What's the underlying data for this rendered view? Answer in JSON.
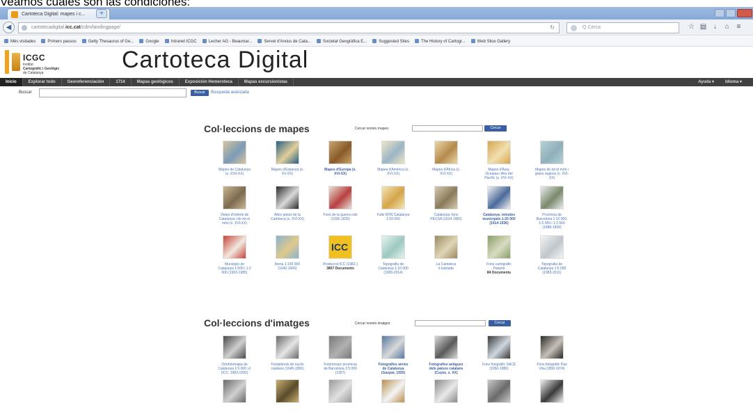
{
  "caption": "Veamos cuáles son las condiciones:",
  "browser": {
    "tab_title": "Cartoteca Digital: mapes i c...",
    "url_path": "cartotecadigital.",
    "url_domain": "icc.cat",
    "url_rest": "/cdm/landingpage/",
    "search_placeholder": "Q Cerca",
    "bookmarks": [
      "Més visitades",
      "Primers passos",
      "Getty Thesaurus of Ge...",
      "Google",
      "Intranet ICGC",
      "Lecher AG - Beaumar...",
      "Servei d'Arxius de Cata...",
      "Societat Geogràfica E...",
      "Suggested Sites",
      "The History of Cartogr...",
      "Web Slice Gallery"
    ]
  },
  "site": {
    "logo_title": "ICGC",
    "logo_line1": "Institut",
    "logo_line2": "Cartogràfic i Geològic",
    "logo_line3": "de Catalunya",
    "title": "Cartoteca Digital"
  },
  "menu": {
    "items": [
      "Inicio",
      "Explorar todo",
      "Georeferenciación",
      "1714",
      "Mapas geológicos",
      "Exposición Hemeroteca",
      "Mapas excursionistas"
    ],
    "right": [
      "Ayuda",
      "Idioma"
    ]
  },
  "search": {
    "label": "Buscar",
    "button": "Buscar",
    "advanced": "Búsqueda avanzada"
  },
  "maps_section": {
    "title": "Col·leccions de mapes",
    "search_label": "Cercar només mapes:",
    "button": "Cercar",
    "items": [
      {
        "caption": "Mapes de Catalunya (s. XVII-XX)",
        "thumb": "catalunya"
      },
      {
        "caption": "Mapes d'Espanya (s. XV-XX)",
        "thumb": "espanya"
      },
      {
        "caption": "Mapes d'Europa (s. XVI-XX)",
        "thumb": "europa",
        "bold": true
      },
      {
        "caption": "Mapes d'Amèrica (s. XVI-XX)",
        "thumb": "america"
      },
      {
        "caption": "Mapes d'Àfrica (s. XVI-XX)",
        "thumb": "africa"
      },
      {
        "caption": "Mapes d'Àsia, Oceania i illes del Pacífic (s. XVI-XX)",
        "thumb": "asia"
      },
      {
        "caption": "Mapes de tot el món i grans regions (s. XVI-XX)",
        "thumb": "mon"
      },
      {
        "caption": "Vistes d'indrets de Catalunya i de tot el món (s. XVI-XX)",
        "thumb": "vistes"
      },
      {
        "caption": "Atles antics de la Cartoteca (s. XVI-XX)",
        "thumb": "atles"
      },
      {
        "caption": "Fons de la guerra civil (1936-1939)",
        "thumb": "guerra"
      },
      {
        "caption": "Fulls MTN Catalunya 1:50.000",
        "thumb": "mtn"
      },
      {
        "caption": "Catalunya: fons PECSA (1914-1982)",
        "thumb": "pecsa"
      },
      {
        "caption": "Catalunya: minutes municipals 1:25 000 (1914-1936)",
        "thumb": "minutes",
        "bold": true
      },
      {
        "caption": "Província de Barcelona 1:10 000, 1:5 000 i 1:2 000 (1888-1909)",
        "thumb": "barcelona"
      },
      {
        "caption": "Municipis de Catalunya 1:500 i 1:2 000 (1903-1985)",
        "thumb": "municipis"
      },
      {
        "caption": "Iberia 1:100 000 (1942-1943)",
        "thumb": "iberia"
      },
      {
        "caption": "Producció ICC (1982-)",
        "dark": "3807 Documents",
        "thumb": "icc"
      },
      {
        "caption": "Topografia de Catalunya 1:10 000 (1999-2014)",
        "thumb": "topo10"
      },
      {
        "caption": "La Cartoteca il·lustrada",
        "thumb": "illustrada"
      },
      {
        "caption": "Fons cartogràfic Palumir",
        "dark": "84 Documents",
        "thumb": "palumir"
      },
      {
        "caption": "Topografia de Catalunya 1:5 000 (1983-2011)",
        "thumb": "topo5"
      }
    ]
  },
  "images_section": {
    "title": "Col·leccions d'imatges",
    "search_label": "Cercar només imatges:",
    "button": "Cercar",
    "items": [
      {
        "caption": "Ortofotomapa de Catalunya 1:5 000 v1 (ICC, 1983-1992)",
        "thumb": "orto"
      },
      {
        "caption": "Fotoplànols de nuclis catalans (1945-1956)",
        "thumb": "fotoplanols"
      },
      {
        "caption": "Fotomosaic província de Barcelona 1:5 000 (1957)",
        "thumb": "fotomosaic"
      },
      {
        "caption": "Fotografies aèries de Catalunya (Gaspar, 1926)",
        "thumb": "aeries",
        "bold": true
      },
      {
        "caption": "Fotografies antigues dels països catalans (Cuyàs, s. XX)",
        "thumb": "antigues",
        "bold": true
      },
      {
        "caption": "Fons fotogràfic SACE (1950-1986)",
        "thumb": "sace"
      },
      {
        "caption": "Fons fotogràfic Pau Vila (1890-1974)",
        "thumb": "pauvila"
      },
      {
        "caption": "",
        "thumb": "r1"
      },
      {
        "caption": "",
        "thumb": "r2"
      },
      {
        "caption": "",
        "thumb": "r3"
      },
      {
        "caption": "",
        "thumb": "r4"
      },
      {
        "caption": "",
        "thumb": "r5"
      },
      {
        "caption": "",
        "thumb": "r6"
      },
      {
        "caption": "",
        "thumb": "r7"
      }
    ]
  },
  "colors": {
    "menu_bg": "#404040",
    "link": "#4a73b8",
    "button": "#3a5fa0",
    "logo_accent": "#f0a21c"
  }
}
